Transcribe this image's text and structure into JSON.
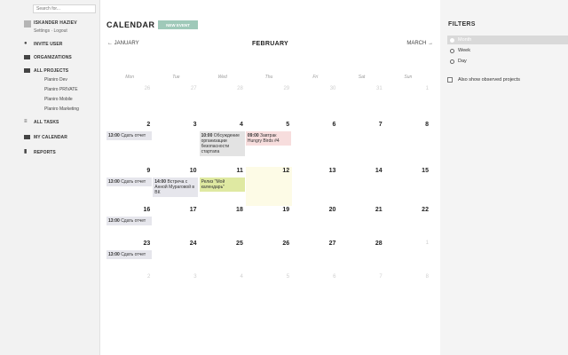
{
  "search": {
    "placeholder": "Search for..."
  },
  "user": {
    "name": "ISKANDER HAZIEV",
    "settings": "Settings",
    "separator": "·",
    "logout": "Logout"
  },
  "nav": {
    "invite": "INVITE USER",
    "organizations": "ORGANIZATIONS",
    "all_projects": "ALL PROJECTS",
    "projects": [
      "Planiro Dev",
      "Planiro PRIVATE",
      "Planiro Mobile",
      "Planiro Marketing"
    ],
    "all_tasks": "ALL TASKS",
    "my_calendar": "MY CALENDAR",
    "reports": "REPORTS"
  },
  "calendar": {
    "title": "CALENDAR",
    "new_event": "NEW EVENT",
    "prev_month": "JANUARY",
    "current_month": "FEBRUARY",
    "next_month": "MARCH",
    "weekdays": [
      "Mon",
      "Tue",
      "Wed",
      "Thu",
      "Fri",
      "Sat",
      "Sun"
    ],
    "weeks": [
      [
        {
          "n": "26",
          "o": true
        },
        {
          "n": "27",
          "o": true
        },
        {
          "n": "28",
          "o": true
        },
        {
          "n": "29",
          "o": true
        },
        {
          "n": "30",
          "o": true
        },
        {
          "n": "31",
          "o": true
        },
        {
          "n": "1",
          "o": true
        }
      ],
      [
        {
          "n": "2"
        },
        {
          "n": "3"
        },
        {
          "n": "4"
        },
        {
          "n": "5"
        },
        {
          "n": "6"
        },
        {
          "n": "7"
        },
        {
          "n": "8"
        }
      ],
      [
        {
          "n": "9"
        },
        {
          "n": "10"
        },
        {
          "n": "11"
        },
        {
          "n": "12",
          "today": true
        },
        {
          "n": "13"
        },
        {
          "n": "14"
        },
        {
          "n": "15"
        }
      ],
      [
        {
          "n": "16"
        },
        {
          "n": "17"
        },
        {
          "n": "18"
        },
        {
          "n": "19"
        },
        {
          "n": "20"
        },
        {
          "n": "21"
        },
        {
          "n": "22"
        }
      ],
      [
        {
          "n": "23"
        },
        {
          "n": "24"
        },
        {
          "n": "25"
        },
        {
          "n": "26"
        },
        {
          "n": "27"
        },
        {
          "n": "28"
        },
        {
          "n": "1",
          "o": true
        }
      ],
      [
        {
          "n": "2",
          "o": true
        },
        {
          "n": "3",
          "o": true
        },
        {
          "n": "4",
          "o": true
        },
        {
          "n": "5",
          "o": true
        },
        {
          "n": "6",
          "o": true
        },
        {
          "n": "7",
          "o": true
        },
        {
          "n": "8",
          "o": true
        }
      ]
    ],
    "events": [
      {
        "week": 1,
        "day": 0,
        "time": "13:00",
        "text": "Сдать отчет",
        "color": "gray"
      },
      {
        "week": 1,
        "day": 2,
        "time": "10:00",
        "text": "Обсуждение организации безопасности стартапа",
        "color": "graydark"
      },
      {
        "week": 1,
        "day": 3,
        "time": "09:00",
        "text": "Завтрак Hungry Birds #4",
        "color": "pink"
      },
      {
        "week": 2,
        "day": 0,
        "time": "13:00",
        "text": "Сдать отчет",
        "color": "gray"
      },
      {
        "week": 2,
        "day": 1,
        "time": "14:00",
        "text": "Встреча с Анной Мураговой в ВК",
        "color": "gray"
      },
      {
        "week": 2,
        "day": 2,
        "time": "",
        "text": "Релиз \"Мой календарь\"",
        "color": "lime"
      },
      {
        "week": 3,
        "day": 0,
        "time": "13:00",
        "text": "Сдать отчет",
        "color": "gray"
      },
      {
        "week": 4,
        "day": 0,
        "time": "13:00",
        "text": "Сдать отчет",
        "color": "gray"
      }
    ]
  },
  "filters": {
    "title": "FILTERS",
    "options": [
      {
        "label": "Month",
        "selected": true
      },
      {
        "label": "Week",
        "selected": false
      },
      {
        "label": "Day",
        "selected": false
      }
    ],
    "observed_label": "Also show observed projects"
  }
}
